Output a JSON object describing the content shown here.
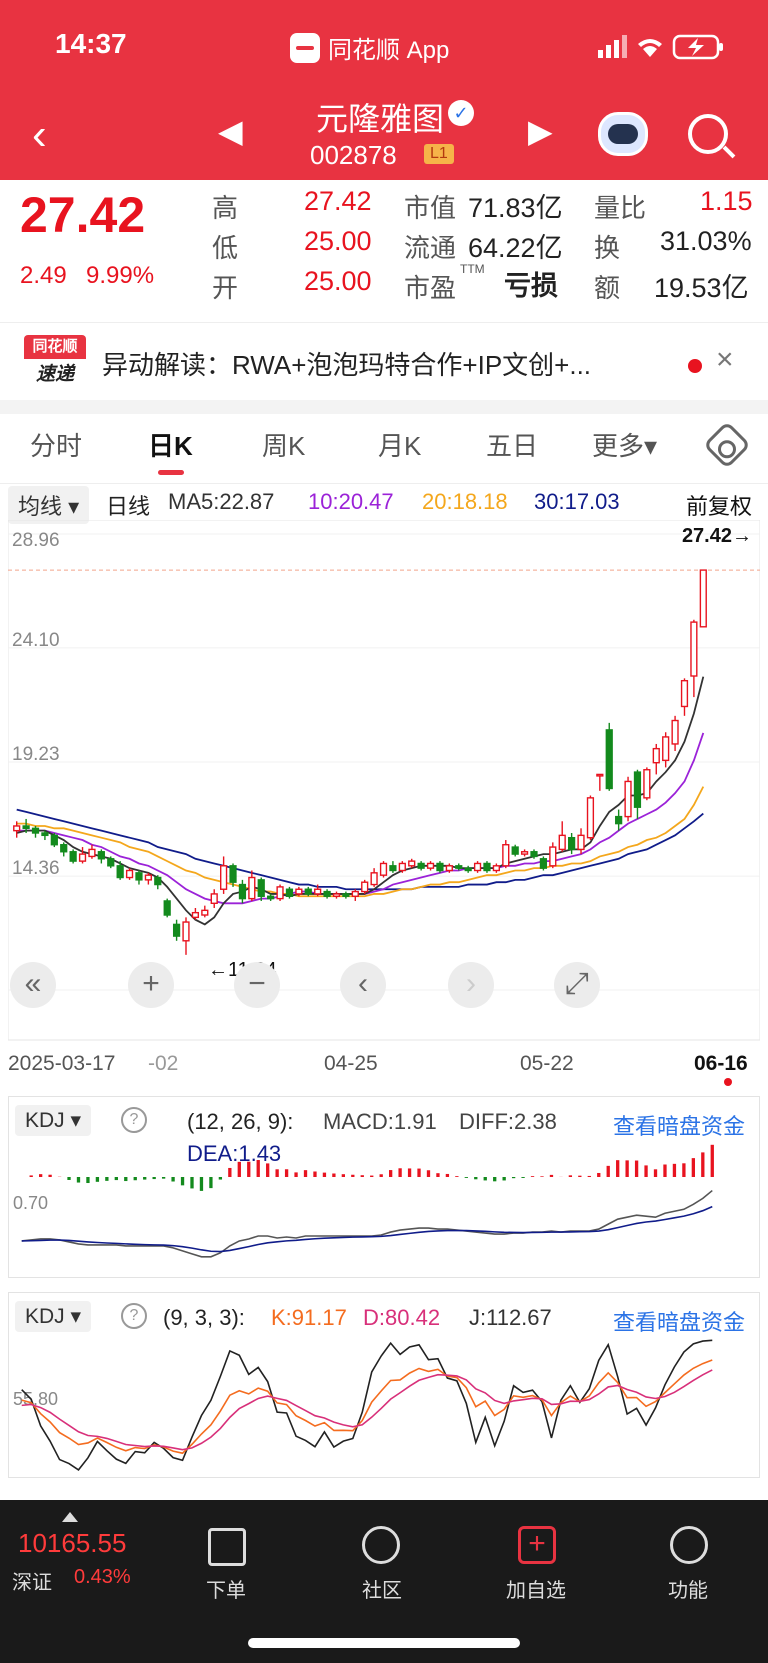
{
  "status": {
    "time": "14:37",
    "app": "同花顺 App"
  },
  "header": {
    "back": "‹",
    "prev": "◀",
    "next": "▶",
    "name": "元隆雅图",
    "verify": "✓",
    "code": "002878",
    "level": "L1"
  },
  "quote": {
    "price": "27.42",
    "change": "2.49",
    "pct": "9.99%",
    "high_label": "高",
    "high": "27.42",
    "low_label": "低",
    "low": "25.00",
    "open_label": "开",
    "open": "25.00",
    "mcap_label": "市值",
    "mcap": "71.83亿",
    "float_label": "流通",
    "float": "64.22亿",
    "pe_label": "市盈",
    "pe_sup": "TTM",
    "pe": "亏损",
    "vr_label": "量比",
    "vr": "1.15",
    "turn_label": "换",
    "turn": "31.03%",
    "amt_label": "额",
    "amt": "19.53亿"
  },
  "news": {
    "logo_top": "同花顺",
    "logo_bottom": "速递",
    "text": "异动解读：RWA+泡泡玛特合作+IP文创+...",
    "close": "×"
  },
  "tabs": [
    "分时",
    "日K",
    "周K",
    "月K",
    "五日",
    "更多▾"
  ],
  "ma": {
    "button": "均线 ▾",
    "period": "日线",
    "ma5": "MA5:22.87",
    "ma10": "10:20.47",
    "ma20": "20:18.18",
    "ma30": "30:17.03",
    "adjust": "前复权"
  },
  "colors": {
    "up": "#e8131f",
    "down": "#138a1d",
    "ma5": "#333333",
    "ma10": "#9b22d8",
    "ma20": "#f4a71c",
    "ma30": "#101c8a",
    "accent": "#e83341"
  },
  "chart_data": {
    "type": "candlestick",
    "ylim": [
      9.5,
      28.96
    ],
    "yticks": [
      "28.96",
      "24.10",
      "19.23",
      "14.36",
      "9.50"
    ],
    "high_mark": "27.42→",
    "low_mark": "←11.04",
    "xlabels": [
      "2025-03-17",
      "-02",
      "04-25",
      "05-22",
      "06-16"
    ],
    "candles": [
      [
        16.3,
        16.5,
        16.0,
        16.7
      ],
      [
        16.5,
        16.4,
        16.2,
        16.8
      ],
      [
        16.4,
        16.2,
        16.0,
        16.5
      ],
      [
        16.2,
        16.1,
        15.9,
        16.3
      ],
      [
        16.1,
        15.7,
        15.6,
        16.2
      ],
      [
        15.7,
        15.4,
        15.2,
        15.8
      ],
      [
        15.4,
        15.0,
        14.9,
        15.5
      ],
      [
        15.0,
        15.3,
        14.9,
        15.6
      ],
      [
        15.2,
        15.5,
        15.1,
        15.7
      ],
      [
        15.4,
        15.1,
        14.9,
        15.5
      ],
      [
        15.1,
        14.8,
        14.7,
        15.2
      ],
      [
        14.8,
        14.3,
        14.2,
        15.0
      ],
      [
        14.3,
        14.6,
        14.2,
        14.7
      ],
      [
        14.5,
        14.2,
        14.0,
        14.6
      ],
      [
        14.2,
        14.4,
        14.0,
        14.5
      ],
      [
        14.3,
        14.0,
        13.8,
        14.4
      ],
      [
        13.3,
        12.7,
        12.6,
        13.4
      ],
      [
        12.3,
        11.8,
        11.6,
        12.5
      ],
      [
        11.6,
        12.4,
        11.0,
        12.6
      ],
      [
        12.6,
        12.8,
        12.5,
        13.0
      ],
      [
        12.7,
        12.9,
        12.6,
        13.1
      ],
      [
        13.2,
        13.6,
        13.0,
        13.8
      ],
      [
        13.8,
        14.8,
        13.6,
        15.2
      ],
      [
        14.8,
        14.1,
        13.9,
        14.9
      ],
      [
        14.0,
        13.4,
        13.2,
        14.2
      ],
      [
        13.4,
        14.3,
        13.3,
        14.6
      ],
      [
        14.2,
        13.5,
        13.3,
        14.3
      ],
      [
        13.5,
        13.4,
        13.3,
        13.6
      ],
      [
        13.4,
        13.9,
        13.3,
        14.0
      ],
      [
        13.8,
        13.5,
        13.4,
        13.9
      ],
      [
        13.6,
        13.8,
        13.5,
        13.9
      ],
      [
        13.8,
        13.6,
        13.5,
        13.9
      ],
      [
        13.6,
        13.8,
        13.5,
        14.0
      ],
      [
        13.7,
        13.5,
        13.4,
        13.8
      ],
      [
        13.5,
        13.6,
        13.4,
        13.7
      ],
      [
        13.6,
        13.5,
        13.4,
        13.7
      ],
      [
        13.5,
        13.7,
        13.3,
        13.8
      ],
      [
        13.7,
        14.1,
        13.6,
        14.2
      ],
      [
        14.0,
        14.5,
        13.9,
        14.7
      ],
      [
        14.4,
        14.9,
        14.3,
        15.0
      ],
      [
        14.8,
        14.6,
        14.5,
        15.0
      ],
      [
        14.6,
        14.9,
        14.5,
        15.0
      ],
      [
        14.8,
        15.0,
        14.7,
        15.1
      ],
      [
        14.9,
        14.7,
        14.6,
        15.0
      ],
      [
        14.7,
        14.9,
        14.6,
        15.0
      ],
      [
        14.9,
        14.6,
        14.5,
        15.0
      ],
      [
        14.6,
        14.8,
        14.5,
        14.9
      ],
      [
        14.8,
        14.7,
        14.6,
        14.9
      ],
      [
        14.7,
        14.6,
        14.5,
        14.8
      ],
      [
        14.6,
        14.9,
        14.5,
        15.0
      ],
      [
        14.9,
        14.6,
        14.5,
        15.0
      ],
      [
        14.6,
        14.8,
        14.5,
        14.9
      ],
      [
        14.8,
        15.7,
        14.7,
        15.9
      ],
      [
        15.6,
        15.3,
        15.2,
        15.7
      ],
      [
        15.3,
        15.4,
        15.2,
        15.5
      ],
      [
        15.4,
        15.2,
        15.1,
        15.5
      ],
      [
        15.1,
        14.7,
        14.6,
        15.2
      ],
      [
        14.8,
        15.6,
        14.7,
        15.8
      ],
      [
        15.5,
        16.1,
        15.4,
        16.7
      ],
      [
        16.0,
        15.5,
        15.3,
        16.2
      ],
      [
        15.5,
        16.1,
        15.3,
        16.4
      ],
      [
        16.0,
        17.7,
        15.9,
        17.8
      ],
      [
        18.7,
        18.7,
        18.0,
        18.7
      ],
      [
        20.6,
        18.1,
        18.0,
        20.9
      ],
      [
        16.9,
        16.6,
        16.3,
        17.2
      ],
      [
        16.9,
        18.4,
        16.7,
        18.6
      ],
      [
        18.8,
        17.3,
        16.8,
        18.9
      ],
      [
        17.7,
        18.9,
        17.6,
        19.0
      ],
      [
        19.2,
        19.8,
        18.7,
        20.0
      ],
      [
        19.3,
        20.3,
        19.0,
        20.5
      ],
      [
        20.0,
        21.0,
        19.7,
        21.2
      ],
      [
        21.6,
        22.7,
        21.2,
        22.8
      ],
      [
        22.9,
        25.2,
        22.0,
        25.3
      ],
      [
        25.0,
        27.42,
        25.0,
        27.42
      ]
    ],
    "ma5": [
      16.2,
      16.3,
      16.3,
      16.3,
      16.1,
      15.9,
      15.6,
      15.4,
      15.3,
      15.2,
      15.1,
      14.9,
      14.7,
      14.6,
      14.5,
      14.3,
      13.9,
      13.4,
      12.9,
      12.5,
      12.3,
      12.6,
      13.2,
      13.6,
      13.7,
      13.9,
      13.8,
      13.6,
      13.6,
      13.5,
      13.6,
      13.6,
      13.6,
      13.6,
      13.6,
      13.6,
      13.6,
      13.6,
      13.8,
      14.1,
      14.4,
      14.6,
      14.7,
      14.8,
      14.8,
      14.8,
      14.8,
      14.7,
      14.7,
      14.7,
      14.7,
      14.7,
      14.9,
      15.0,
      15.1,
      15.2,
      15.3,
      15.3,
      15.4,
      15.5,
      15.5,
      15.8,
      16.5,
      17.1,
      17.4,
      17.8,
      17.8,
      17.9,
      18.4,
      18.8,
      19.3,
      20.1,
      21.3,
      22.87
    ],
    "ma10": [
      16.3,
      16.3,
      16.3,
      16.3,
      16.2,
      16.1,
      16.0,
      15.9,
      15.7,
      15.6,
      15.4,
      15.2,
      15.1,
      14.9,
      14.8,
      14.6,
      14.4,
      14.1,
      13.8,
      13.6,
      13.4,
      13.3,
      13.2,
      13.2,
      13.2,
      13.3,
      13.4,
      13.4,
      13.5,
      13.6,
      13.7,
      13.7,
      13.6,
      13.6,
      13.6,
      13.6,
      13.6,
      13.6,
      13.7,
      13.8,
      14.0,
      14.1,
      14.2,
      14.3,
      14.4,
      14.5,
      14.6,
      14.6,
      14.7,
      14.7,
      14.7,
      14.7,
      14.8,
      14.8,
      14.9,
      14.9,
      15.0,
      15.0,
      15.1,
      15.2,
      15.3,
      15.5,
      15.8,
      16.0,
      16.3,
      16.6,
      16.8,
      17.0,
      17.2,
      17.5,
      17.9,
      18.4,
      19.3,
      20.47
    ],
    "ma20": [
      16.6,
      16.6,
      16.5,
      16.5,
      16.4,
      16.4,
      16.3,
      16.2,
      16.1,
      16.0,
      15.9,
      15.8,
      15.6,
      15.5,
      15.4,
      15.2,
      15.0,
      14.8,
      14.6,
      14.5,
      14.3,
      14.2,
      14.1,
      14.0,
      13.9,
      13.8,
      13.7,
      13.7,
      13.6,
      13.6,
      13.5,
      13.5,
      13.5,
      13.5,
      13.5,
      13.5,
      13.5,
      13.5,
      13.6,
      13.6,
      13.7,
      13.8,
      13.8,
      13.9,
      14.0,
      14.0,
      14.1,
      14.1,
      14.2,
      14.3,
      14.4,
      14.4,
      14.5,
      14.6,
      14.6,
      14.7,
      14.7,
      14.8,
      14.8,
      14.9,
      14.9,
      15.0,
      15.2,
      15.3,
      15.4,
      15.6,
      15.7,
      15.9,
      16.0,
      16.2,
      16.5,
      16.8,
      17.4,
      18.18
    ],
    "ma30": [
      17.2,
      17.1,
      17.0,
      16.9,
      16.8,
      16.7,
      16.6,
      16.5,
      16.4,
      16.3,
      16.2,
      16.1,
      16.0,
      15.9,
      15.8,
      15.6,
      15.5,
      15.4,
      15.3,
      15.1,
      15.0,
      14.9,
      14.8,
      14.7,
      14.6,
      14.5,
      14.4,
      14.3,
      14.2,
      14.1,
      14.0,
      14.0,
      13.9,
      13.9,
      13.9,
      13.8,
      13.8,
      13.8,
      13.8,
      13.8,
      13.8,
      13.8,
      13.8,
      13.9,
      13.9,
      13.9,
      13.9,
      13.9,
      14.0,
      14.0,
      14.0,
      14.1,
      14.1,
      14.2,
      14.2,
      14.3,
      14.4,
      14.4,
      14.5,
      14.6,
      14.7,
      14.8,
      14.9,
      15.0,
      15.1,
      15.3,
      15.4,
      15.5,
      15.7,
      15.9,
      16.1,
      16.4,
      16.7,
      17.03
    ]
  },
  "tools": [
    "«",
    "+",
    "−",
    "‹",
    "›",
    "⤢"
  ],
  "macd": {
    "button": "KDJ ▾",
    "help": "?",
    "params": "(12, 26, 9):",
    "macd": "MACD:1.91",
    "diff": "DIFF:2.38",
    "dea": "DEA:1.43",
    "link": "查看暗盘资金",
    "tick": "0.70"
  },
  "kdj": {
    "button": "KDJ ▾",
    "help": "?",
    "params": "(9, 3, 3):",
    "k": "K:91.17",
    "d": "D:80.42",
    "j": "J:112.67",
    "link": "查看暗盘资金",
    "tick": "55.80"
  },
  "bottom": {
    "index_value": "10165.55",
    "index_name": "深证",
    "index_pct": "0.43%",
    "b1": "下单",
    "b2": "社区",
    "b3": "加自选",
    "b4": "功能"
  }
}
